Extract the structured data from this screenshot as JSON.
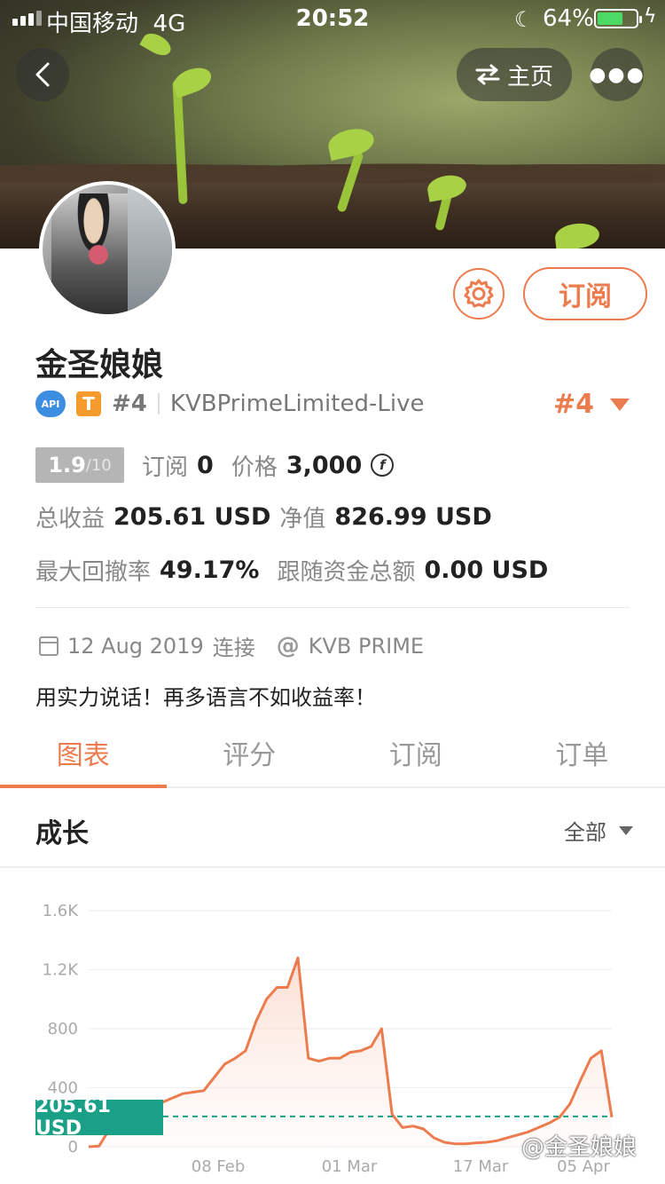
{
  "status_bar": {
    "carrier": "中国移动",
    "network": "4G",
    "time": "20:52",
    "battery": "64%"
  },
  "nav": {
    "home_label": "主页"
  },
  "profile": {
    "name": "金圣娘娘",
    "api_label": "API",
    "tier_label": "T",
    "rank": "#4",
    "account": "KVBPrimeLimited-Live",
    "rank_right": "#4"
  },
  "actions": {
    "subscribe_label": "订阅"
  },
  "stats": {
    "score": "1.9",
    "score_max": "/10",
    "subscribe_label": "订阅",
    "subscribe_count": "0",
    "price_label": "价格",
    "price_value": "3,000",
    "coin_symbol": "f",
    "total_profit_label": "总收益",
    "total_profit_value": "205.61 USD",
    "net_value_label": "净值",
    "net_value_value": "826.99 USD",
    "drawdown_label": "最大回撤率",
    "drawdown_value": "49.17%",
    "follow_label": "跟随资金总额",
    "follow_value": "0.00 USD"
  },
  "meta": {
    "date": "12 Aug 2019",
    "connected": "连接",
    "at": "@",
    "broker": "KVB PRIME"
  },
  "bio": "用实力说话！再多语言不如收益率！",
  "tabs": [
    "图表",
    "评分",
    "订阅",
    "订单"
  ],
  "section": {
    "title": "成长",
    "filter": "全部"
  },
  "current_value_badge": "205.61 USD",
  "watermark": "@金圣娘娘",
  "colors": {
    "accent": "#ec7b4e",
    "badge": "#1aa086",
    "api": "#3d8de0",
    "tier": "#f59b2e"
  },
  "chart_data": {
    "type": "area",
    "y_ticks": [
      "1.6K",
      "1.2K",
      "800",
      "400",
      "0"
    ],
    "x_ticks": [
      "08 Feb",
      "01 Mar",
      "17 Mar",
      "05 Apr"
    ],
    "ylim": [
      0,
      1600
    ],
    "reference_line": 205.61,
    "x": [
      0,
      5,
      10,
      15,
      20,
      25,
      30,
      35,
      40,
      45,
      50,
      55,
      60,
      65,
      70,
      75,
      80,
      85,
      90,
      95,
      100,
      105,
      110,
      115,
      120,
      125,
      130,
      135,
      140,
      145,
      150,
      155,
      160,
      165,
      170,
      175,
      180,
      185,
      190,
      195,
      200,
      205,
      210,
      215,
      220,
      225,
      230,
      235,
      240,
      245,
      250
    ],
    "values": [
      0,
      5,
      120,
      250,
      280,
      290,
      300,
      300,
      330,
      360,
      370,
      380,
      470,
      560,
      600,
      650,
      850,
      1000,
      1080,
      1080,
      1280,
      600,
      580,
      600,
      600,
      640,
      650,
      680,
      800,
      220,
      130,
      140,
      120,
      60,
      30,
      20,
      20,
      25,
      30,
      40,
      60,
      80,
      100,
      130,
      160,
      200,
      290,
      450,
      600,
      650,
      200
    ]
  }
}
